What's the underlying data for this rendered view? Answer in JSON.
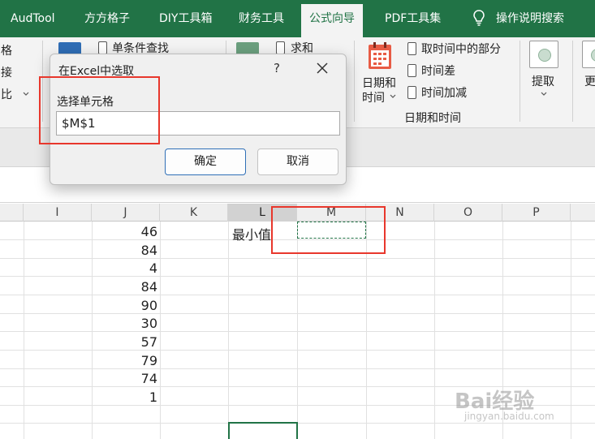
{
  "ribbon_tabs": [
    {
      "label": "AudTool",
      "active": false
    },
    {
      "label": "方方格子",
      "active": false
    },
    {
      "label": "DIY工具箱",
      "active": false
    },
    {
      "label": "财务工具",
      "active": false
    },
    {
      "label": "公式向导",
      "active": true
    },
    {
      "label": "PDF工具集",
      "active": false
    },
    {
      "label": "操作说明搜索",
      "active": false
    }
  ],
  "ribbon": {
    "left_partial": [
      "格",
      "接",
      "比"
    ],
    "lookup": {
      "single_condition_lookup": "单条件查找"
    },
    "sum_label": "求和",
    "datetime": {
      "big_button_line1": "日期和",
      "big_button_line2": "时间",
      "items": [
        "取时间中的部分",
        "时间差",
        "时间加减"
      ],
      "group_label": "日期和时间"
    },
    "extract_label": "提取",
    "more_partial": "更"
  },
  "dialog": {
    "title": "在Excel中选取",
    "help": "?",
    "label": "选择单元格",
    "input_value": "$M$1",
    "ok": "确定",
    "cancel": "取消"
  },
  "grid": {
    "columns": [
      "I",
      "J",
      "K",
      "L",
      "M",
      "N",
      "O",
      "P"
    ],
    "selected_column": "L",
    "j_values": [
      "46",
      "84",
      "4",
      "84",
      "90",
      "30",
      "57",
      "79",
      "74",
      "1"
    ],
    "l1_text": "最小值"
  },
  "colors": {
    "excel_green": "#217346",
    "highlight_red": "#e8372c",
    "ok_border_blue": "#2f6fb7"
  },
  "watermark": {
    "text": "Bai经验",
    "subtext": "jingyan.baidu.com"
  }
}
